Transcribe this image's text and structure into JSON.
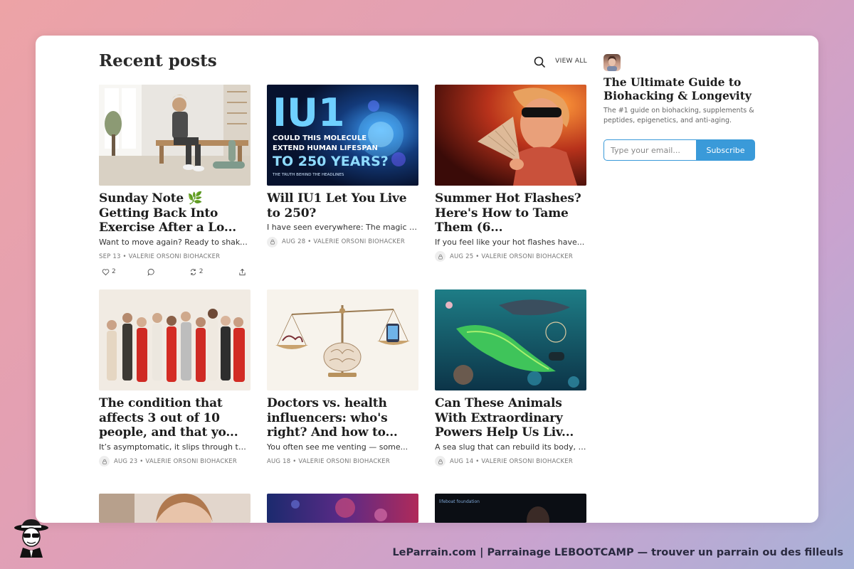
{
  "header": {
    "title": "Recent posts",
    "view_all": "VIEW ALL"
  },
  "posts": [
    {
      "title": "Sunday Note 🌿 Getting Back Into Exercise After a Lo...",
      "excerpt": "Want to move again? Ready to shake ...",
      "date": "SEP 13",
      "author": "VALERIE ORSONI BIOHACKER",
      "locked": false,
      "actions": {
        "likes": "2",
        "restacks": "2"
      }
    },
    {
      "title": "Will IU1 Let You Live to 250?",
      "excerpt": "I have seen everywhere: The magic pi...",
      "date": "AUG 28",
      "author": "VALERIE ORSONI BIOHACKER",
      "locked": true
    },
    {
      "title": "Summer Hot Flashes? Here's How to Tame Them (6...",
      "excerpt": "If you feel like your hot flashes have...",
      "date": "AUG 25",
      "author": "VALERIE ORSONI BIOHACKER",
      "locked": true
    },
    {
      "title": "The condition that affects 3 out of 10 people, and that yo...",
      "excerpt": "It’s asymptomatic, it slips through the...",
      "date": "AUG 23",
      "author": "VALERIE ORSONI BIOHACKER",
      "locked": true
    },
    {
      "title": "Doctors vs. health influencers: who's right? And how to...",
      "excerpt": "You often see me venting — some...",
      "date": "AUG 18",
      "author": "VALERIE ORSONI BIOHACKER",
      "locked": false
    },
    {
      "title": "Can These Animals With Extraordinary Powers Help Us Liv...",
      "excerpt": "A sea slug that can rebuild its body, a...",
      "date": "AUG 14",
      "author": "VALERIE ORSONI BIOHACKER",
      "locked": true
    }
  ],
  "thumb_text": {
    "iu1_big": "IU1",
    "iu1_line1": "COULD THIS MOLECULE",
    "iu1_line2": "EXTEND HUMAN LIFESPAN",
    "iu1_line3": "TO 250 YEARS?",
    "iu1_line4": "THE TRUTH BEHIND THE HEADLINES",
    "lifeboat": "lifeboat foundation"
  },
  "sidebar": {
    "title": "The Ultimate Guide to Biohacking & Longevity",
    "description": "The #1 guide on biohacking, supplements & peptides, epigenetics, and anti-aging.",
    "email_placeholder": "Type your email...",
    "subscribe_label": "Subscribe"
  },
  "footer": {
    "text": "LeParrain.com | Parrainage LEBOOTCAMP — trouver un parrain ou des filleuls"
  },
  "colors": {
    "accent": "#3a9ad9",
    "title": "#1d1d1d"
  }
}
